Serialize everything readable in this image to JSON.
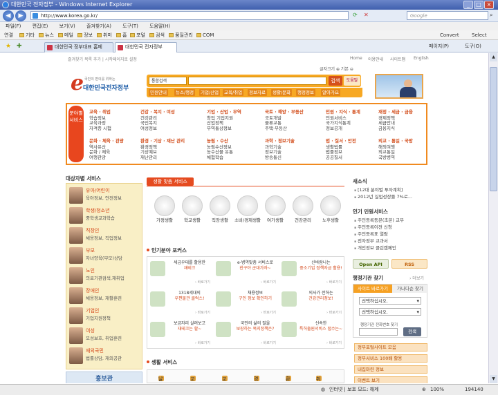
{
  "window": {
    "title": "대한민국 전자정부 - Windows Internet Explorer"
  },
  "address": {
    "url": "http://www.korea.go.kr/",
    "search_placeholder": "Google"
  },
  "menu": [
    "파일(F)",
    "편집(E)",
    "보기(V)",
    "즐겨찾기(A)",
    "도구(T)",
    "도움말(H)"
  ],
  "favorites": {
    "label": "연결",
    "items": [
      "기타",
      "뉴스",
      "메일",
      "정보",
      "취미",
      "홈",
      "포털",
      "검색",
      "품질관리",
      "COM"
    ],
    "convert": "Convert",
    "select": "Select"
  },
  "tabs": [
    "대한민국 정부대표 홈페이...",
    "대한민국 전자정부"
  ],
  "toolbar_right": {
    "page": "페이지(P)",
    "tools": "도구(O)"
  },
  "page": {
    "top_links": "즐겨찾기 목록 추가 | 시작페이지로 설정",
    "util_nav": [
      "Home",
      "이용안내",
      "사이트맵",
      "English"
    ],
    "font_control": "글자크기 ⊕ 기본 ⊖",
    "logo": {
      "letter": "e",
      "name": "대한민국전자정부",
      "tagline": "국민의 편의를 위하는"
    },
    "search": {
      "select": "통합검색",
      "button": "검색",
      "help": "도움말"
    },
    "categories": [
      "민원안내",
      "뉴스/행정",
      "기업/산업",
      "교육/취업",
      "정보자료",
      "생활/문화",
      "행정정보",
      "알아가요"
    ],
    "service_side": "분야별 서비스",
    "service_cols": [
      {
        "h": "교육 · 취업",
        "items": [
          "학습정보",
          "교육과정",
          "자격증 시험"
        ]
      },
      {
        "h": "건강 · 복지 · 여성",
        "items": [
          "건강관리",
          "국민복지",
          "여성정보"
        ]
      },
      {
        "h": "기업 · 산업 · 무역",
        "items": [
          "창업 기업지원",
          "산업정책",
          "무역통상정보"
        ]
      },
      {
        "h": "국토 · 해양 · 부동산",
        "items": [
          "국토개발",
          "물류교통",
          "주택·부동산"
        ]
      },
      {
        "h": "민원 · 지식 · 통계",
        "items": [
          "민원서비스",
          "국가지식통계",
          "정보공개"
        ]
      },
      {
        "h": "재정 · 세금 · 금융",
        "items": [
          "경제정책",
          "세금안내",
          "금융지식"
        ]
      },
      {
        "h": "문화 · 체육 · 관광",
        "items": [
          "역사유산",
          "문화 / 체육",
          "여행관광"
        ]
      },
      {
        "h": "환경 · 기상 · 재난 관리",
        "items": [
          "환경정책",
          "기상예보",
          "재난관리"
        ]
      },
      {
        "h": "농림 · 수산",
        "items": [
          "농림수산정보",
          "농수산물 유통",
          "체험학습"
        ]
      },
      {
        "h": "과학 · 정보기술",
        "items": [
          "과학기술",
          "정보기술",
          "방송통신"
        ]
      },
      {
        "h": "법 · 질서 · 안전",
        "items": [
          "생활법률",
          "법률정보",
          "공공질서"
        ]
      },
      {
        "h": "외교 · 통일 · 국방",
        "items": [
          "해외여행",
          "외교통일",
          "국방병역"
        ]
      }
    ],
    "target_title": "대상자별 서비스",
    "targets": [
      {
        "t": "유아/어린이",
        "d": "육아정보, 안전정보"
      },
      {
        "t": "학생/청소년",
        "d": "중학생교과학습"
      },
      {
        "t": "직장인",
        "d": "채용정보, 직업정보"
      },
      {
        "t": "부모",
        "d": "자녀양육(부모)상담"
      },
      {
        "t": "노인",
        "d": "의료기관검색,재취업"
      },
      {
        "t": "장애인",
        "d": "채용정보, 재활훈련"
      },
      {
        "t": "기업인",
        "d": "기업지원정책"
      },
      {
        "t": "여성",
        "d": "모성보호, 취업훈련"
      },
      {
        "t": "재외국민",
        "d": "법률상담, 재외공관"
      }
    ],
    "cyber": "홍보관",
    "life_tab": "생활 맞춤 서비스",
    "life_icons": [
      "가정생활",
      "학교생활",
      "직장생활",
      "소비/경제생활",
      "여가생활",
      "건강관리",
      "노후생활"
    ],
    "popular_title": "인기분야 포커스",
    "popular": [
      {
        "a": "세금우대를 활용한",
        "b": "재테크",
        "more": "› 바로가기"
      },
      {
        "a": "e-병역맞춤 서비스로",
        "b": "친구야 군대가자~",
        "more": "› 바로가기"
      },
      {
        "a": "신바람나는",
        "b": "중소기업 정책자금 활용!",
        "more": "› 바로가기"
      },
      {
        "a": "1318세대의",
        "b": "우편물관 클럭스!",
        "more": "› 바로가기"
      },
      {
        "a": "채용정보",
        "b": "구인 정보 확인하기",
        "more": "› 바로가기"
      },
      {
        "a": "의사가 전하는",
        "b": "건강관리정보!",
        "more": "› 바로가기"
      },
      {
        "a": "보금자리 살려보고",
        "b": "재테크는 할~",
        "more": "› 바로가기"
      },
      {
        "a": "국민의 삶의 질을",
        "b": "보장하는 복지정책은?",
        "more": "› 바로가기"
      },
      {
        "a": "신속한",
        "b": "특허출원서비스 접수는~",
        "more": "› 바로가기"
      }
    ],
    "life_service_title": "생활 서비스",
    "life_service": [
      "날씨",
      "교통",
      "교육",
      "경제",
      "환경",
      "취업"
    ],
    "news_title": "새소식",
    "news": [
      "[12대 분야별 투자계획]",
      "2012년 실업성장률 7%로..."
    ],
    "popular_svc_title": "인기 민원서비스",
    "popular_svc": [
      "주민등록등본(초본) 교부",
      "주민등록이전 신청",
      "주민등록표 열람",
      "전자정부 교과서",
      "개인정보 클린캠페인"
    ],
    "open_api": "Open API",
    "rss": "RSS",
    "org_title": "행정기관 찾기",
    "org_more": "› 더보기",
    "org_tab1": "사이트 바로가기",
    "org_tab2": "가나다순 찾기",
    "org_select1": "선택하십시오.",
    "org_select2": "선택하십시오.",
    "org_label": "행정기관 전화번호 찾기",
    "org_go": "검색",
    "org_buttons": [
      "정부포털사이트 모음",
      "정부서비스 100배 활용",
      "내집마련 정보",
      "이벤트 보기"
    ]
  },
  "status": {
    "zone": "인터넷 | 보호 모드: 해제",
    "zoom": "100%",
    "count": "194140"
  },
  "colors": {
    "accent": "#f7a823",
    "brand_red": "#e54b20",
    "ie_blue": "#3f5fae"
  }
}
